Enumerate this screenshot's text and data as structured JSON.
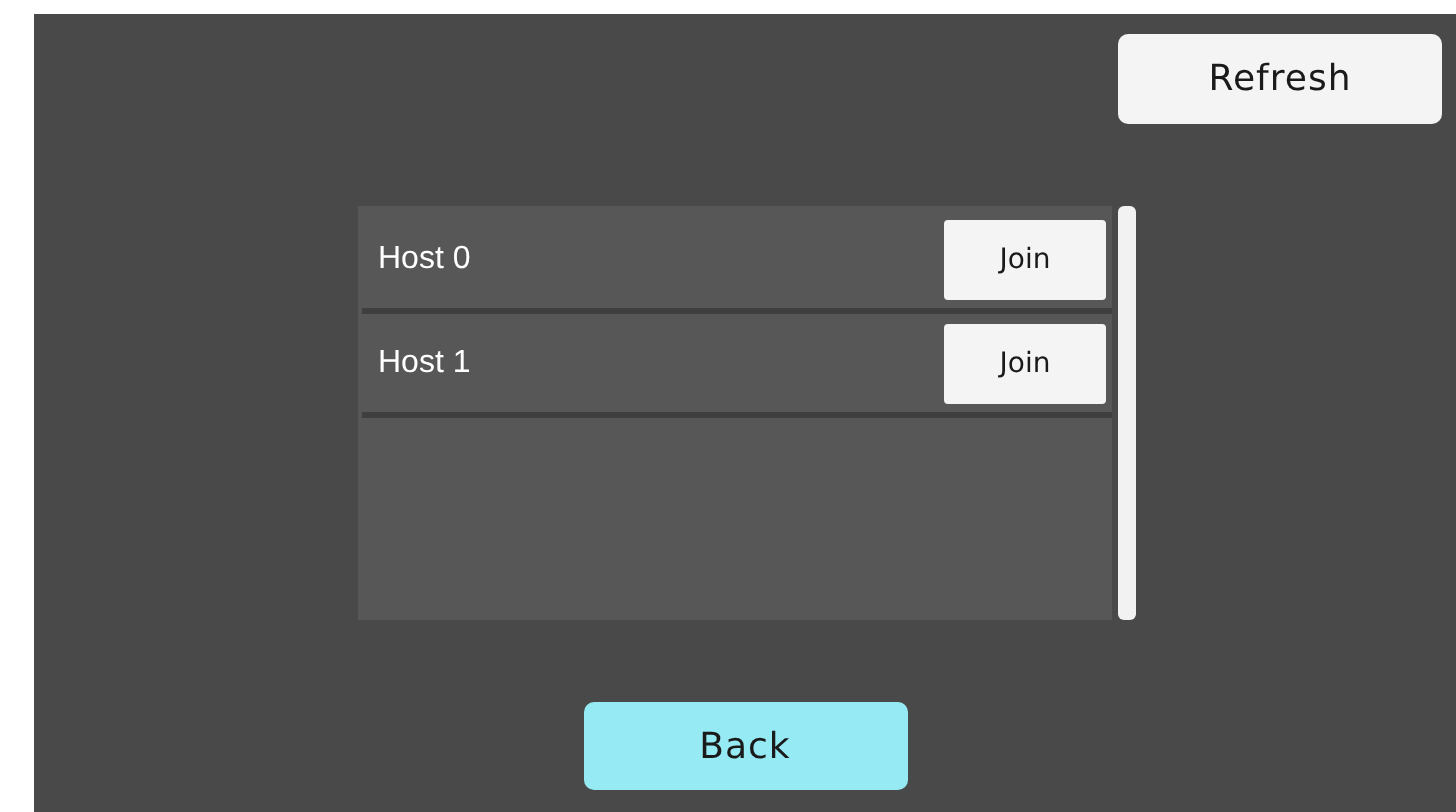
{
  "toolbar": {
    "refresh_button": "Refresh"
  },
  "hosts": [
    {
      "name": "Host 0",
      "join_button": "Join"
    },
    {
      "name": "Host 1",
      "join_button": "Join"
    }
  ],
  "back_button": "Back"
}
